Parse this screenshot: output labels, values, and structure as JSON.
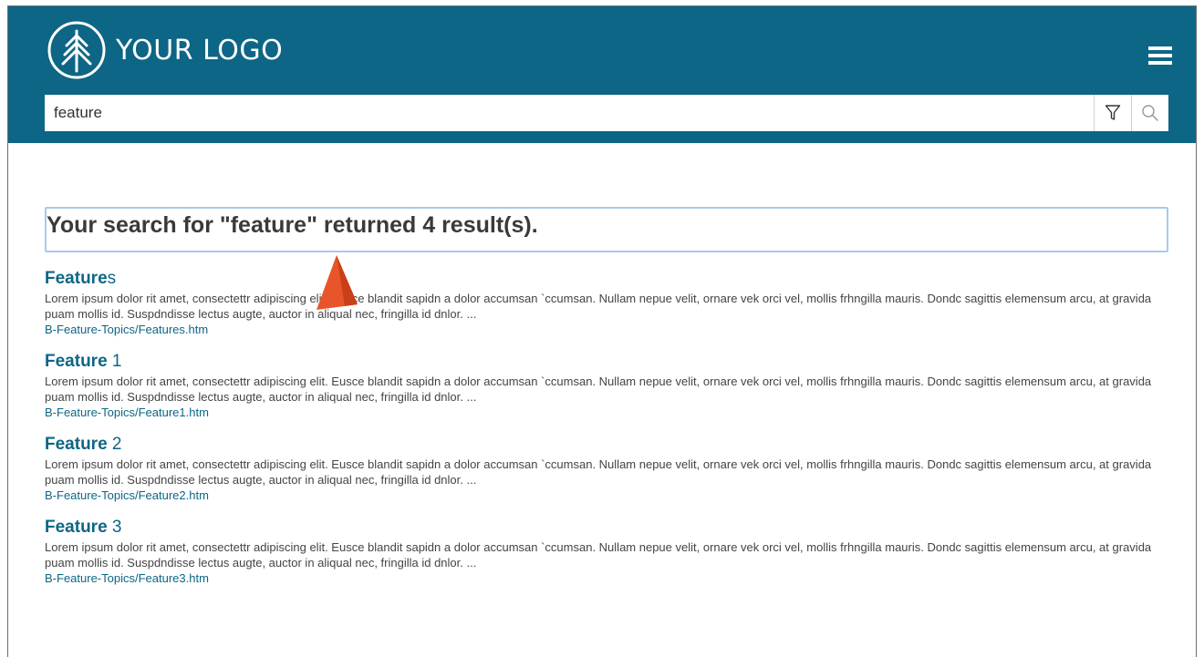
{
  "header": {
    "logo_text": "YOUR LOGO",
    "brand_color": "#0d6685",
    "menu_icon": "hamburger-menu-icon"
  },
  "search": {
    "value": "feature",
    "filter_icon": "filter-icon",
    "search_icon": "search-icon"
  },
  "results": {
    "heading": "Your search for \"feature\" returned 4 result(s).",
    "items": [
      {
        "title_match": "Feature",
        "title_rest": "s",
        "description": "Lorem ipsum dolor rit amet, consectettr adipiscing elit. Eusce blandit sapidn a dolor accumsan `ccumsan. Nullam nepue velit, ornare vek orci vel, mollis frhngilla mauris. Dondc sagittis elemensum arcu, at gravida puam mollis id. Suspdndisse lectus augte, auctor in aliqual nec, fringilla id dnlor. ...",
        "path": "B-Feature-Topics/Features.htm"
      },
      {
        "title_match": "Feature",
        "title_rest": " 1",
        "description": "Lorem ipsum dolor rit amet, consectettr adipiscing elit. Eusce blandit sapidn a dolor accumsan `ccumsan. Nullam nepue velit, ornare vek orci vel, mollis frhngilla mauris. Dondc sagittis elemensum arcu, at gravida puam mollis id. Suspdndisse lectus augte, auctor in aliqual nec, fringilla id dnlor. ...",
        "path": "B-Feature-Topics/Feature1.htm"
      },
      {
        "title_match": "Feature",
        "title_rest": " 2",
        "description": "Lorem ipsum dolor rit amet, consectettr adipiscing elit. Eusce blandit sapidn a dolor accumsan `ccumsan. Nullam nepue velit, ornare vek orci vel, mollis frhngilla mauris. Dondc sagittis elemensum arcu, at gravida puam mollis id. Suspdndisse lectus augte, auctor in aliqual nec, fringilla id dnlor. ...",
        "path": "B-Feature-Topics/Feature2.htm"
      },
      {
        "title_match": "Feature",
        "title_rest": " 3",
        "description": "Lorem ipsum dolor rit amet, consectettr adipiscing elit. Eusce blandit sapidn a dolor accumsan `ccumsan. Nullam nepue velit, ornare vek orci vel, mollis frhngilla mauris. Dondc sagittis elemensum arcu, at gravida puam mollis id. Suspdndisse lectus augte, auctor in aliqual nec, fringilla id dnlor. ...",
        "path": "B-Feature-Topics/Feature3.htm"
      }
    ]
  },
  "annotation": {
    "arrow_icon": "callout-arrow-icon",
    "arrow_color": "#e8552a"
  }
}
